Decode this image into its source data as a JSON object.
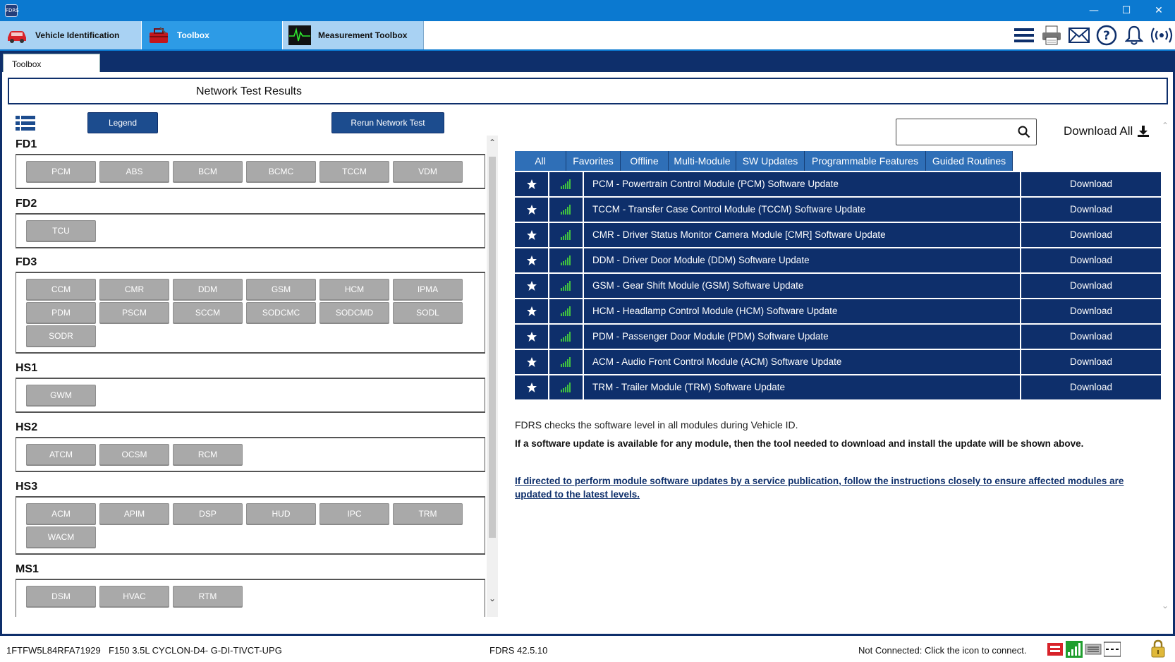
{
  "app": {
    "icon_label": "FDRS",
    "tabs": [
      {
        "label": "Vehicle Identification",
        "icon": "car-icon"
      },
      {
        "label": "Toolbox",
        "icon": "toolbox-icon"
      },
      {
        "label": "Measurement Toolbox",
        "icon": "waveform-icon"
      }
    ],
    "toolbar_icons": [
      "menu-icon",
      "printer-icon",
      "mail-icon",
      "help-icon",
      "bell-icon",
      "broadcast-icon"
    ],
    "subtab": "Toolbox"
  },
  "page_title": "Network Test Results",
  "left": {
    "legend_label": "Legend",
    "rerun_label": "Rerun Network Test",
    "groups": [
      {
        "name": "FD1",
        "modules": [
          "PCM",
          "ABS",
          "BCM",
          "BCMC",
          "TCCM",
          "VDM"
        ]
      },
      {
        "name": "FD2",
        "modules": [
          "TCU"
        ]
      },
      {
        "name": "FD3",
        "modules": [
          "CCM",
          "CMR",
          "DDM",
          "GSM",
          "HCM",
          "IPMA",
          "PDM",
          "PSCM",
          "SCCM",
          "SODCMC",
          "SODCMD",
          "SODL",
          "SODR"
        ]
      },
      {
        "name": "HS1",
        "modules": [
          "GWM"
        ]
      },
      {
        "name": "HS2",
        "modules": [
          "ATCM",
          "OCSM",
          "RCM"
        ]
      },
      {
        "name": "HS3",
        "modules": [
          "ACM",
          "APIM",
          "DSP",
          "HUD",
          "IPC",
          "TRM",
          "WACM"
        ]
      },
      {
        "name": "MS1",
        "modules": [
          "DSM",
          "HVAC",
          "RTM"
        ]
      }
    ]
  },
  "right": {
    "search_placeholder": "",
    "download_all_label": "Download All",
    "filter_tabs": [
      "All",
      "Favorites",
      "Offline",
      "Multi-Module",
      "SW Updates",
      "Programmable Features",
      "Guided Routines"
    ],
    "results": [
      {
        "name": "PCM - Powertrain Control Module (PCM) Software Update",
        "action": "Download"
      },
      {
        "name": "TCCM - Transfer Case Control Module (TCCM) Software Update",
        "action": "Download"
      },
      {
        "name": "CMR - Driver Status Monitor Camera Module [CMR] Software Update",
        "action": "Download"
      },
      {
        "name": "DDM - Driver Door Module (DDM) Software Update",
        "action": "Download"
      },
      {
        "name": "GSM - Gear Shift Module (GSM) Software Update",
        "action": "Download"
      },
      {
        "name": "HCM - Headlamp Control Module (HCM) Software Update",
        "action": "Download"
      },
      {
        "name": "PDM - Passenger Door Module (PDM) Software Update",
        "action": "Download"
      },
      {
        "name": "ACM - Audio Front Control Module (ACM) Software Update",
        "action": "Download"
      },
      {
        "name": "TRM - Trailer Module (TRM) Software Update",
        "action": "Download"
      }
    ],
    "info_line1": "FDRS checks the software level in all modules during Vehicle ID.",
    "info_line2": "If a software update is available for any module, then the tool needed to download and install the update will be shown above.",
    "info_link": "If directed to perform module software updates by a service publication, follow the instructions closely to ensure affected modules are updated to the latest levels."
  },
  "status": {
    "vin": "1FTFW5L84RFA71929",
    "vehicle": "F150 3.5L CYCLON-D4- G-DI-TIVCT-UPG",
    "version": "FDRS 42.5.10",
    "connection": "Not Connected: Click the icon to connect."
  },
  "colors": {
    "titlebar": "#0b79d0",
    "navy": "#0e2f6b",
    "tab_active": "#2d9be6",
    "tab_inactive": "#a9d2f3",
    "filter_tab": "#2f6fb7",
    "module_button": "#a9a9a9",
    "signal_green": "#3fc13f"
  }
}
